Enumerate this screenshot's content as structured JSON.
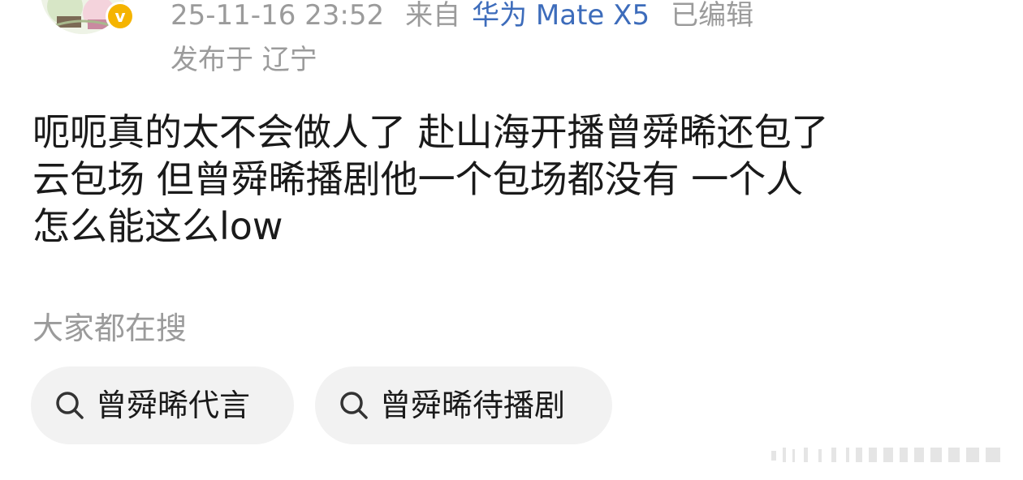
{
  "post_meta": {
    "timestamp": "25-11-16 23:52",
    "source_prefix": "来自",
    "device": "华为 Mate X5",
    "edited": "已编辑",
    "location": "发布于 辽宁"
  },
  "post": {
    "lines": [
      "呃呃真的太不会做人了 赴山海开播曾舜晞还包了",
      "云包场 但曾舜晞播剧他一个包场都没有 一个人",
      "怎么能这么low"
    ]
  },
  "search_suggestions": {
    "label": "大家都在搜",
    "items": [
      {
        "label": "曾舜晞代言"
      },
      {
        "label": "曾舜晞待播剧"
      }
    ]
  },
  "icons": {
    "verified": "verified-badge-icon",
    "search": "search-icon"
  },
  "colors": {
    "meta_gray": "#9b9b9b",
    "device_blue": "#3d6cbb",
    "badge_yellow": "#f5b400",
    "chip_bg": "#f2f2f2"
  }
}
